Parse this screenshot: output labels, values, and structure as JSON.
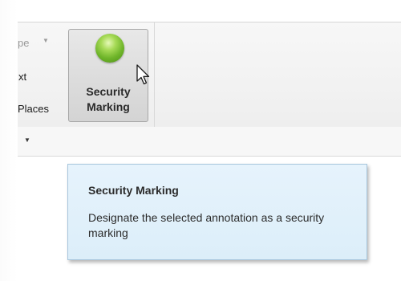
{
  "ribbon": {
    "cropped_items": {
      "top_label": "pe",
      "middle_label": "xt",
      "bottom_label": "Places"
    },
    "security_button": {
      "label_line1": "Security",
      "label_line2": "Marking",
      "icon": "green-orb-icon",
      "orb_color": "#6fb52a"
    }
  },
  "tooltip": {
    "title": "Security Marking",
    "description": "Designate the selected annotation as a security marking",
    "background_color": "#dceef9",
    "border_color": "#a7c6dd"
  }
}
